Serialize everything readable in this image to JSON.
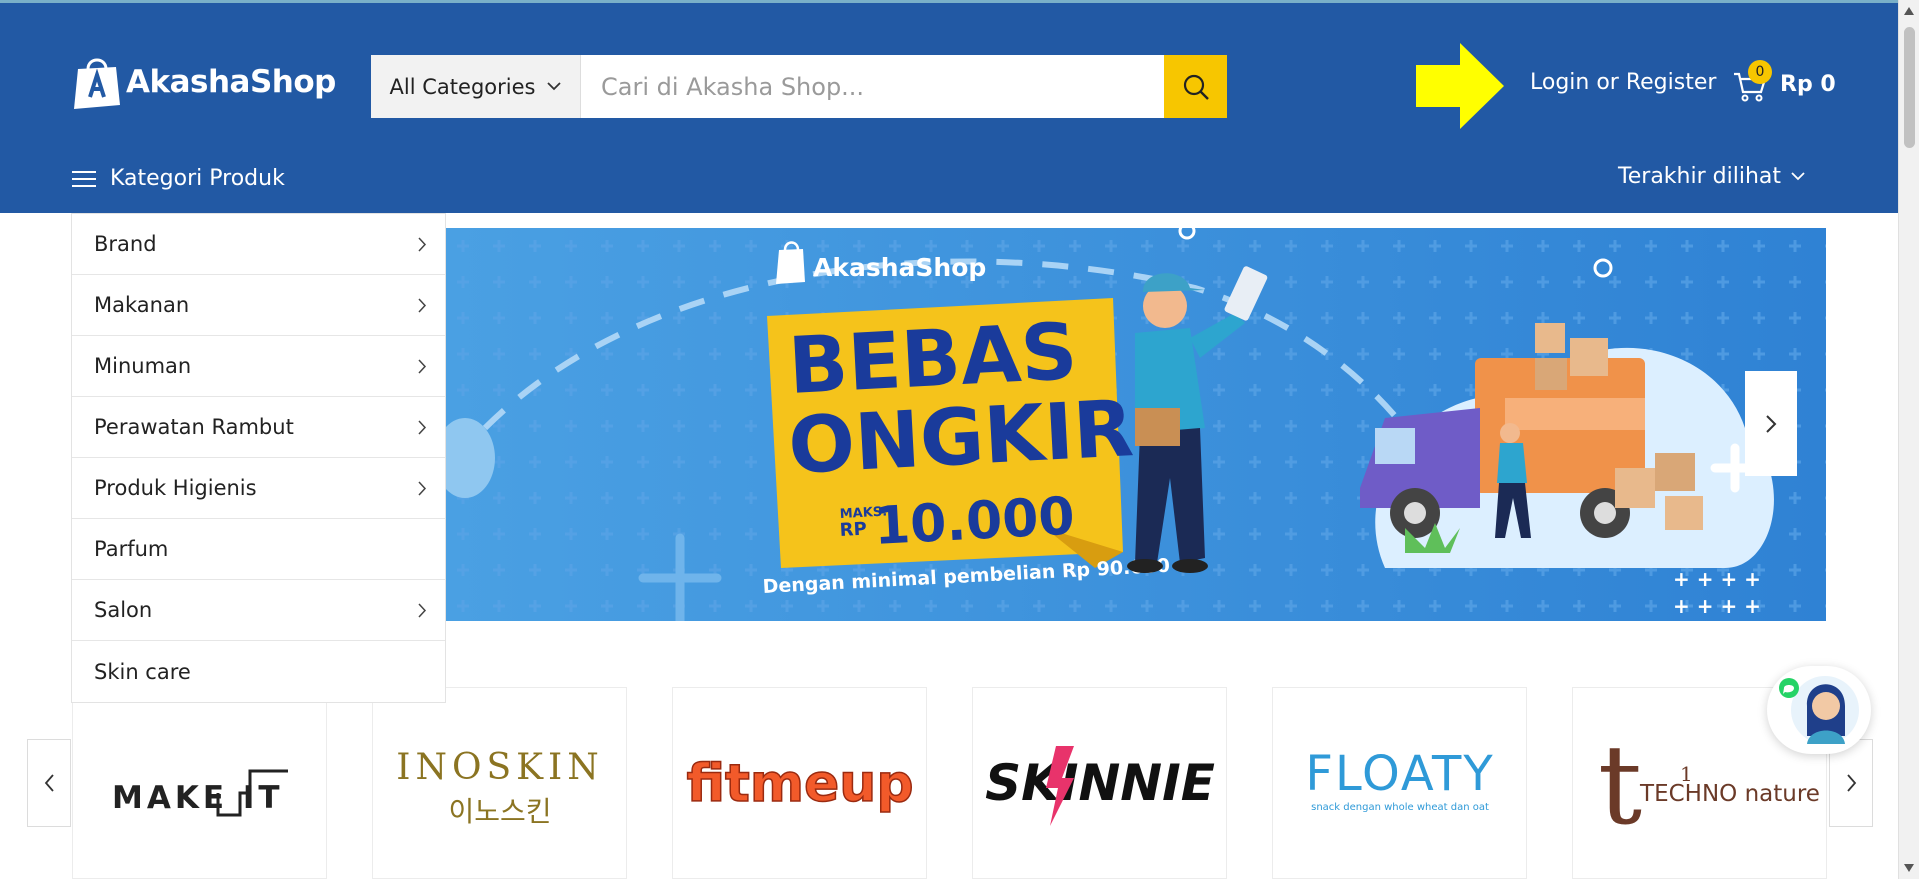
{
  "header": {
    "logo_text": "AkashaShop",
    "brand_color": "#2259a4",
    "accent_color": "#f7c600"
  },
  "search": {
    "category_label": "All Categories",
    "placeholder": "Cari di Akasha Shop...",
    "button_icon": "search-icon"
  },
  "account": {
    "login_label": "Login or Register"
  },
  "cart": {
    "count": "0",
    "total": "Rp 0",
    "icon": "cart-icon"
  },
  "nav": {
    "menu_label": "Kategori Produk",
    "recent_label": "Terakhir dilihat"
  },
  "categories": [
    {
      "label": "Brand",
      "has_sub": true
    },
    {
      "label": "Makanan",
      "has_sub": true
    },
    {
      "label": "Minuman",
      "has_sub": true
    },
    {
      "label": "Perawatan Rambut",
      "has_sub": true
    },
    {
      "label": "Produk Higienis",
      "has_sub": true
    },
    {
      "label": "Parfum",
      "has_sub": false
    },
    {
      "label": "Salon",
      "has_sub": true
    },
    {
      "label": "Skin care",
      "has_sub": false
    }
  ],
  "banner": {
    "logo_text": "AkashaShop",
    "headline_1": "BEBAS",
    "headline_2": "ONGKIR",
    "max_label": "MAKS.",
    "currency": "RP",
    "amount": "10.000",
    "subtext": "Dengan minimal pembelian Rp 90.000"
  },
  "brands": [
    {
      "name": "MAKE IT"
    },
    {
      "name": "INOSKIN",
      "sub": "이노스킨"
    },
    {
      "name": "fitmeup"
    },
    {
      "name": "SKINNIE"
    },
    {
      "name": "FLOATY",
      "sub": "snack dengan whole wheat dan oat"
    },
    {
      "name": "TECHNO nature",
      "mark": "t"
    }
  ]
}
